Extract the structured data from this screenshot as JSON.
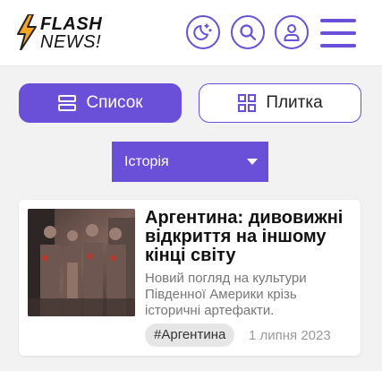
{
  "header": {
    "logo_top": "FLASH",
    "logo_bottom": "NEWS!",
    "icons": [
      "moon-stars-icon",
      "search-icon",
      "user-icon",
      "hamburger-icon"
    ]
  },
  "view_toggle": {
    "list_label": "Список",
    "tile_label": "Плитка",
    "active": "list"
  },
  "category_select": {
    "selected": "Історія"
  },
  "articles": [
    {
      "title": "Аргентина: дивовижні відкриття на іншому кінці світу",
      "description": "Новий погляд на культури Південної Америки крізь історичні артефакти.",
      "tag": "#Аргентина",
      "date": "1 липня 2023"
    }
  ],
  "colors": {
    "accent": "#6a4fd8",
    "logo_bolt": "#f5a623",
    "background": "#f2f2f2"
  }
}
